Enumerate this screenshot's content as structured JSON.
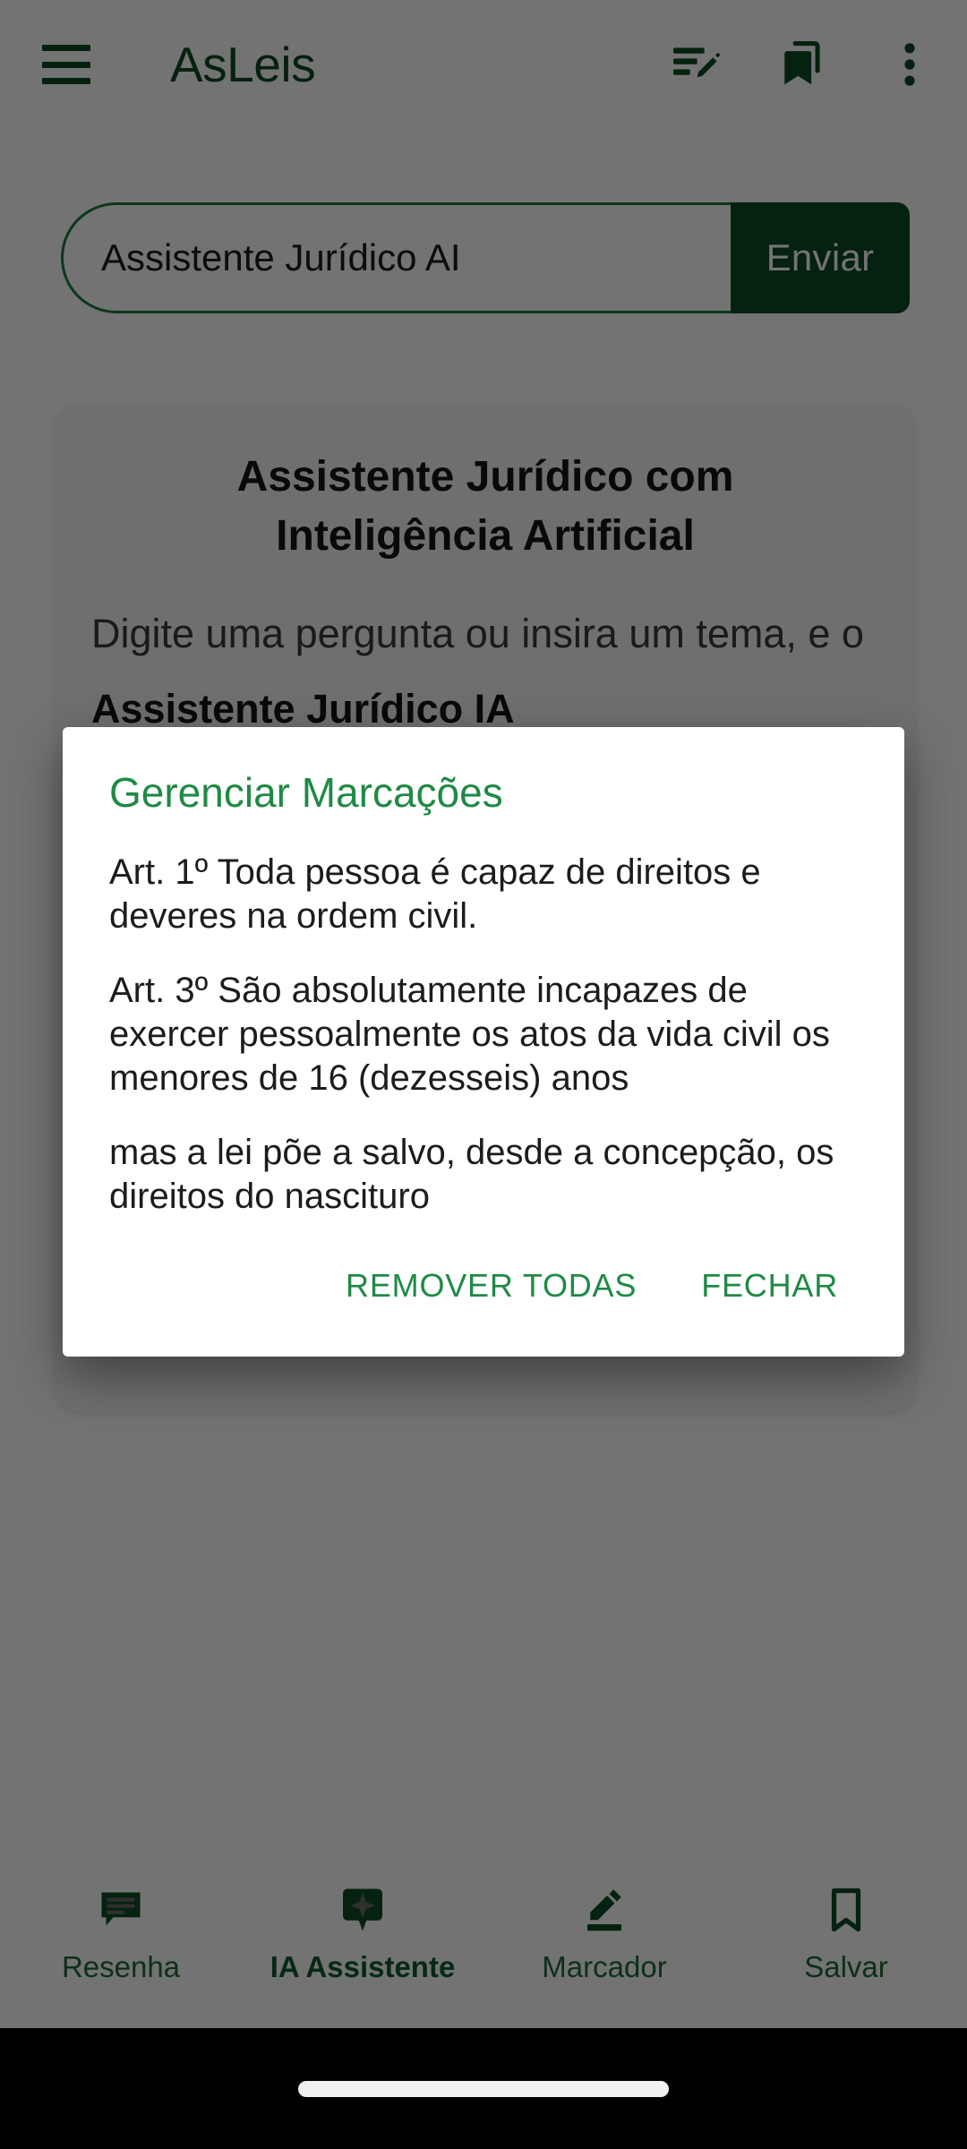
{
  "appbar": {
    "menu_icon": "hamburger-menu-icon",
    "title": "AsLeis",
    "actions": [
      {
        "name": "edit-note-icon",
        "label": "Editar nota"
      },
      {
        "name": "bookmarks-icon",
        "label": "Marcadores"
      },
      {
        "name": "overflow-menu-icon",
        "label": "Mais opções"
      }
    ]
  },
  "search": {
    "placeholder": "Assistente Jurídico AI",
    "value": "",
    "send_label": "Enviar"
  },
  "intro": {
    "title": "Assistente Jurídico com Inteligência Artificial",
    "body_prefix": "Digite uma pergunta ou insira um tema, e o ",
    "body_strong": "Assistente Jurídico IA",
    "body_suffix": ""
  },
  "dialog": {
    "title": "Gerenciar Marcações",
    "items": [
      "Art. 1º Toda pessoa é capaz de direitos e deveres na ordem civil.",
      "Art. 3º São absolutamente incapazes de exercer pessoalmente os atos da vida civil os menores de 16 (dezesseis) anos",
      "mas a lei põe a salvo, desde a concepção, os direitos do nascituro"
    ],
    "remove_all_label": "REMOVER TODAS",
    "close_label": "FECHAR"
  },
  "bottom_nav": {
    "items": [
      {
        "label": "Resenha",
        "icon": "comment-lines-icon",
        "active": false
      },
      {
        "label": "IA Assistente",
        "icon": "sparkle-bubble-icon",
        "active": true
      },
      {
        "label": "Marcador",
        "icon": "highlighter-pen-icon",
        "active": false
      },
      {
        "label": "Salvar",
        "icon": "bookmark-icon",
        "active": false
      }
    ]
  },
  "colors": {
    "brand_dark_green": "#0d4a22",
    "brand_green": "#1f8a45",
    "nav_green": "#1b6b35",
    "scrim": "rgba(0,0,0,0.55)"
  }
}
